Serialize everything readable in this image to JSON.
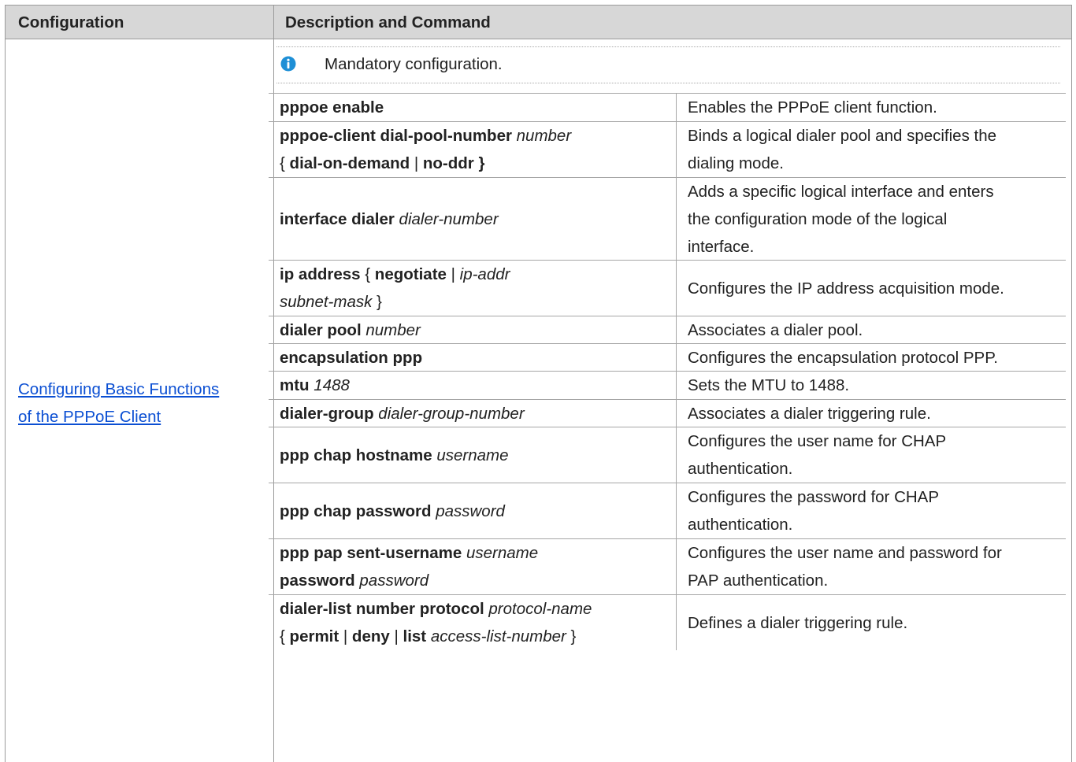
{
  "header": {
    "col1": "Configuration",
    "col2": "Description and Command"
  },
  "section_link": {
    "line1": "Configuring Basic Functions ",
    "line2": "of the PPPoE Client"
  },
  "note": {
    "icon": "info-icon",
    "icon_color": "#1e8fd6",
    "text": "Mandatory configuration."
  },
  "commands": [
    {
      "cmd": [
        [
          "b",
          "pppoe enable"
        ]
      ],
      "desc": [
        "Enables the PPPoE client function."
      ]
    },
    {
      "cmd": [
        [
          "b",
          "pppoe-client dial-pool-number "
        ],
        [
          "i",
          "number"
        ],
        [
          "br",
          ""
        ],
        [
          "t",
          "{ "
        ],
        [
          "b",
          "dial-on-demand"
        ],
        [
          "t",
          " | "
        ],
        [
          "b",
          "no-ddr }"
        ]
      ],
      "desc": [
        "Binds a logical dialer pool and specifies the",
        "dialing mode."
      ]
    },
    {
      "cmd": [
        [
          "b",
          "interface dialer "
        ],
        [
          "i",
          "dialer-number"
        ]
      ],
      "desc": [
        "Adds a specific logical interface and enters",
        "the configuration mode of the logical",
        "interface."
      ]
    },
    {
      "cmd": [
        [
          "b",
          "ip address"
        ],
        [
          "t",
          " { "
        ],
        [
          "b",
          "negotiate"
        ],
        [
          "t",
          " | "
        ],
        [
          "i",
          "ip-addr"
        ],
        [
          "br",
          ""
        ],
        [
          "i",
          "subnet-mask"
        ],
        [
          "t",
          " }"
        ]
      ],
      "desc": [
        "Configures the IP address acquisition mode."
      ]
    },
    {
      "cmd": [
        [
          "b",
          "dialer pool "
        ],
        [
          "i",
          "number"
        ]
      ],
      "desc": [
        "Associates a dialer pool."
      ]
    },
    {
      "cmd": [
        [
          "b",
          "encapsulation ppp"
        ]
      ],
      "desc": [
        "Configures the encapsulation protocol PPP."
      ]
    },
    {
      "cmd": [
        [
          "b",
          "mtu "
        ],
        [
          "i",
          "1488"
        ]
      ],
      "desc": [
        "Sets the MTU to 1488."
      ]
    },
    {
      "cmd": [
        [
          "b",
          "dialer-group "
        ],
        [
          "i",
          "dialer-group-number"
        ]
      ],
      "desc": [
        "Associates a dialer triggering rule."
      ]
    },
    {
      "cmd": [
        [
          "b",
          "ppp chap hostname "
        ],
        [
          "i",
          "username"
        ]
      ],
      "desc": [
        "Configures the user name for CHAP",
        "authentication."
      ]
    },
    {
      "cmd": [
        [
          "b",
          "ppp chap password "
        ],
        [
          "i",
          "password"
        ]
      ],
      "desc": [
        "Configures the password for CHAP",
        "authentication."
      ]
    },
    {
      "cmd": [
        [
          "b",
          "ppp pap sent-username "
        ],
        [
          "i",
          "username"
        ],
        [
          "br",
          ""
        ],
        [
          "b",
          "password "
        ],
        [
          "i",
          "password"
        ]
      ],
      "desc": [
        "Configures the user name and password for",
        "PAP authentication."
      ]
    },
    {
      "cmd": [
        [
          "b",
          "dialer-list number protocol "
        ],
        [
          "i",
          "protocol-name"
        ],
        [
          "br",
          ""
        ],
        [
          "t",
          "{ "
        ],
        [
          "b",
          "permit"
        ],
        [
          "t",
          " | "
        ],
        [
          "b",
          "deny"
        ],
        [
          "t",
          " | "
        ],
        [
          "b",
          "list "
        ],
        [
          "i",
          "access-list-number"
        ],
        [
          "t",
          " }"
        ]
      ],
      "desc": [
        "Defines a dialer triggering rule."
      ]
    }
  ]
}
